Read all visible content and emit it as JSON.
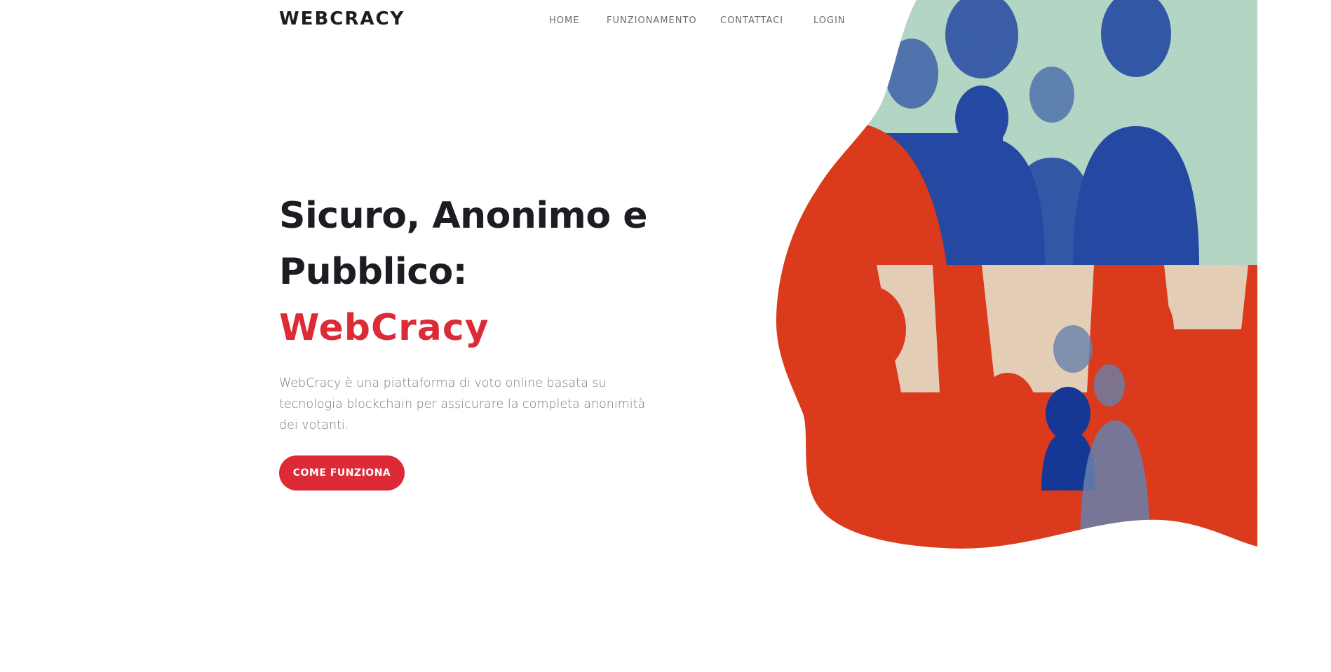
{
  "header": {
    "brand": "WEBCRACY",
    "nav": {
      "home": "HOME",
      "funzionamento": "FUNZIONAMENTO",
      "contattaci": "CONTATTACI",
      "login": "LOGIN"
    }
  },
  "hero": {
    "title_line1": "Sicuro, Anonimo e",
    "title_line2": "Pubblico:",
    "title_highlight": "WebCracy",
    "description": "WebCracy è una piattaforma di voto online basata su tecnologia blockchain per assicurare la completa anonimità dei votanti.",
    "cta_label": "COME FUNZIONA"
  },
  "colors": {
    "accent": "#dc2a36",
    "text_dark": "#1c1c22",
    "text_muted": "#7a7a7a",
    "nav_text": "#6d6d6d",
    "art_blue": "#2a4fae",
    "art_red": "#ea3f22",
    "art_mint": "#bfe4d2",
    "art_cream": "#f3dcc2"
  },
  "icons": {
    "hero_image": "crowd-illustration"
  }
}
